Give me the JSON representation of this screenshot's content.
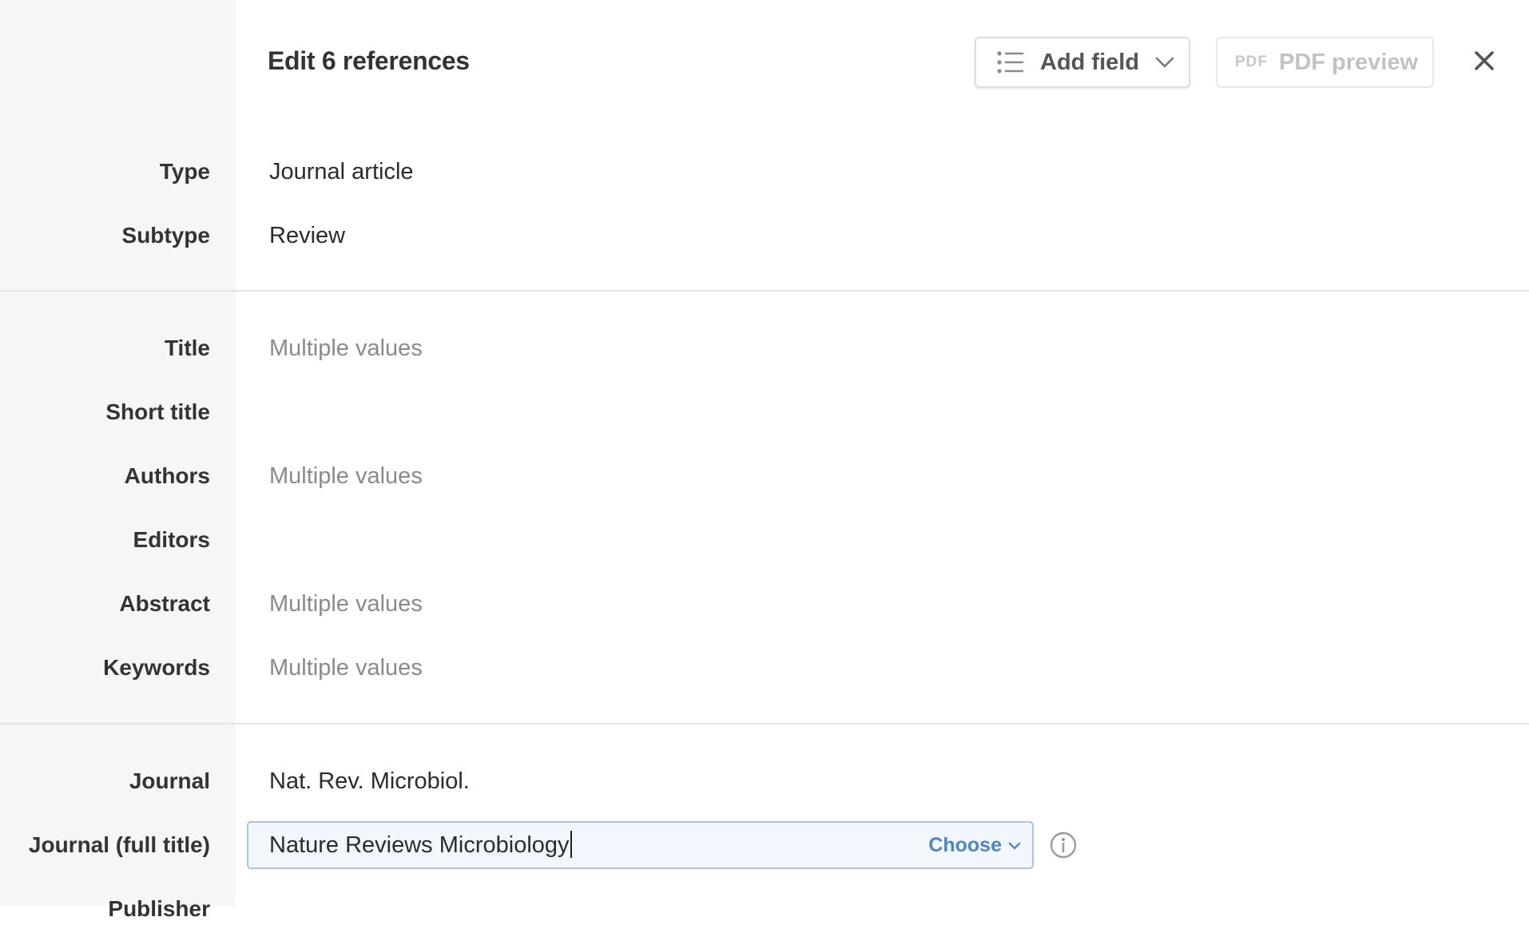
{
  "header": {
    "title": "Edit 6 references",
    "add_field_label": "Add field",
    "pdf_badge": "PDF",
    "pdf_preview_label": "PDF preview"
  },
  "fields": {
    "type": {
      "label": "Type",
      "value": "Journal article"
    },
    "subtype": {
      "label": "Subtype",
      "value": "Review"
    },
    "title": {
      "label": "Title",
      "value": "Multiple values"
    },
    "short_title": {
      "label": "Short title",
      "value": ""
    },
    "authors": {
      "label": "Authors",
      "value": "Multiple values"
    },
    "editors": {
      "label": "Editors",
      "value": ""
    },
    "abstract": {
      "label": "Abstract",
      "value": "Multiple values"
    },
    "keywords": {
      "label": "Keywords",
      "value": "Multiple values"
    },
    "journal": {
      "label": "Journal",
      "value": "Nat. Rev. Microbiol."
    },
    "journal_full": {
      "label": "Journal (full title)",
      "value": "Nature Reviews Microbiology",
      "choose_label": "Choose"
    },
    "publisher": {
      "label": "Publisher"
    }
  },
  "icons": {
    "add_field": "list-icon",
    "close": "close-icon",
    "info": "info-icon"
  },
  "colors": {
    "accent": "#4f86c6",
    "sidebar_bg": "#f6f6f6",
    "muted_text": "#8a8a8a",
    "active_field_border": "#a8c4e6"
  }
}
